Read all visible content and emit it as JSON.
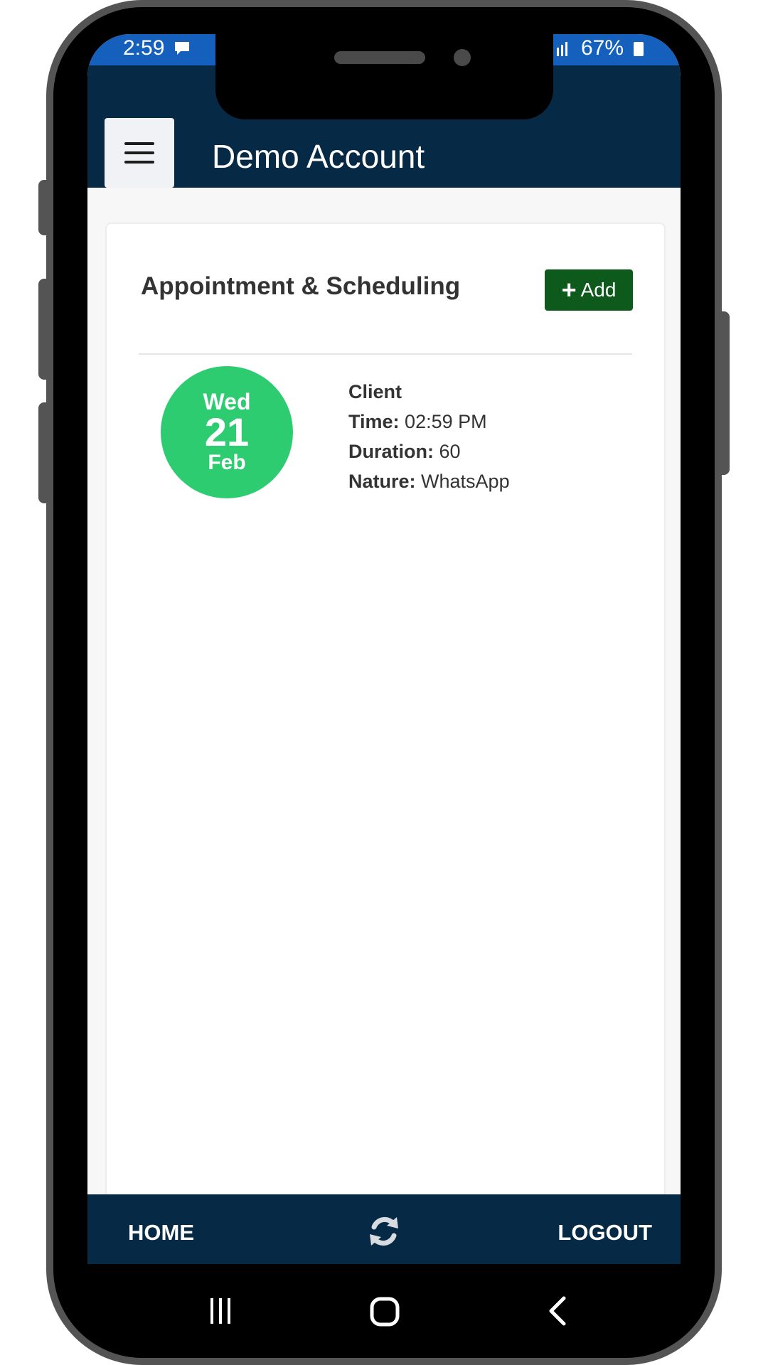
{
  "status_bar": {
    "time": "2:59",
    "battery": "67%"
  },
  "header": {
    "title": "Demo Account",
    "menu_icon": "hamburger-menu-icon"
  },
  "card": {
    "title": "Appointment & Scheduling",
    "add_label": "Add"
  },
  "appointment": {
    "date": {
      "dow": "Wed",
      "day": "21",
      "month": "Feb"
    },
    "client_label": "Client",
    "time_label": "Time:",
    "time_value": "02:59 PM",
    "duration_label": "Duration:",
    "duration_value": "60",
    "nature_label": "Nature:",
    "nature_value": "WhatsApp"
  },
  "bottom_nav": {
    "home": "HOME",
    "logout": "LOGOUT",
    "refresh_icon": "refresh-icon"
  },
  "colors": {
    "header_bg": "#062a45",
    "status_bar_bg": "#1560bd",
    "add_button_bg": "#0e5a1d",
    "date_circle_bg": "#2ecc71"
  }
}
